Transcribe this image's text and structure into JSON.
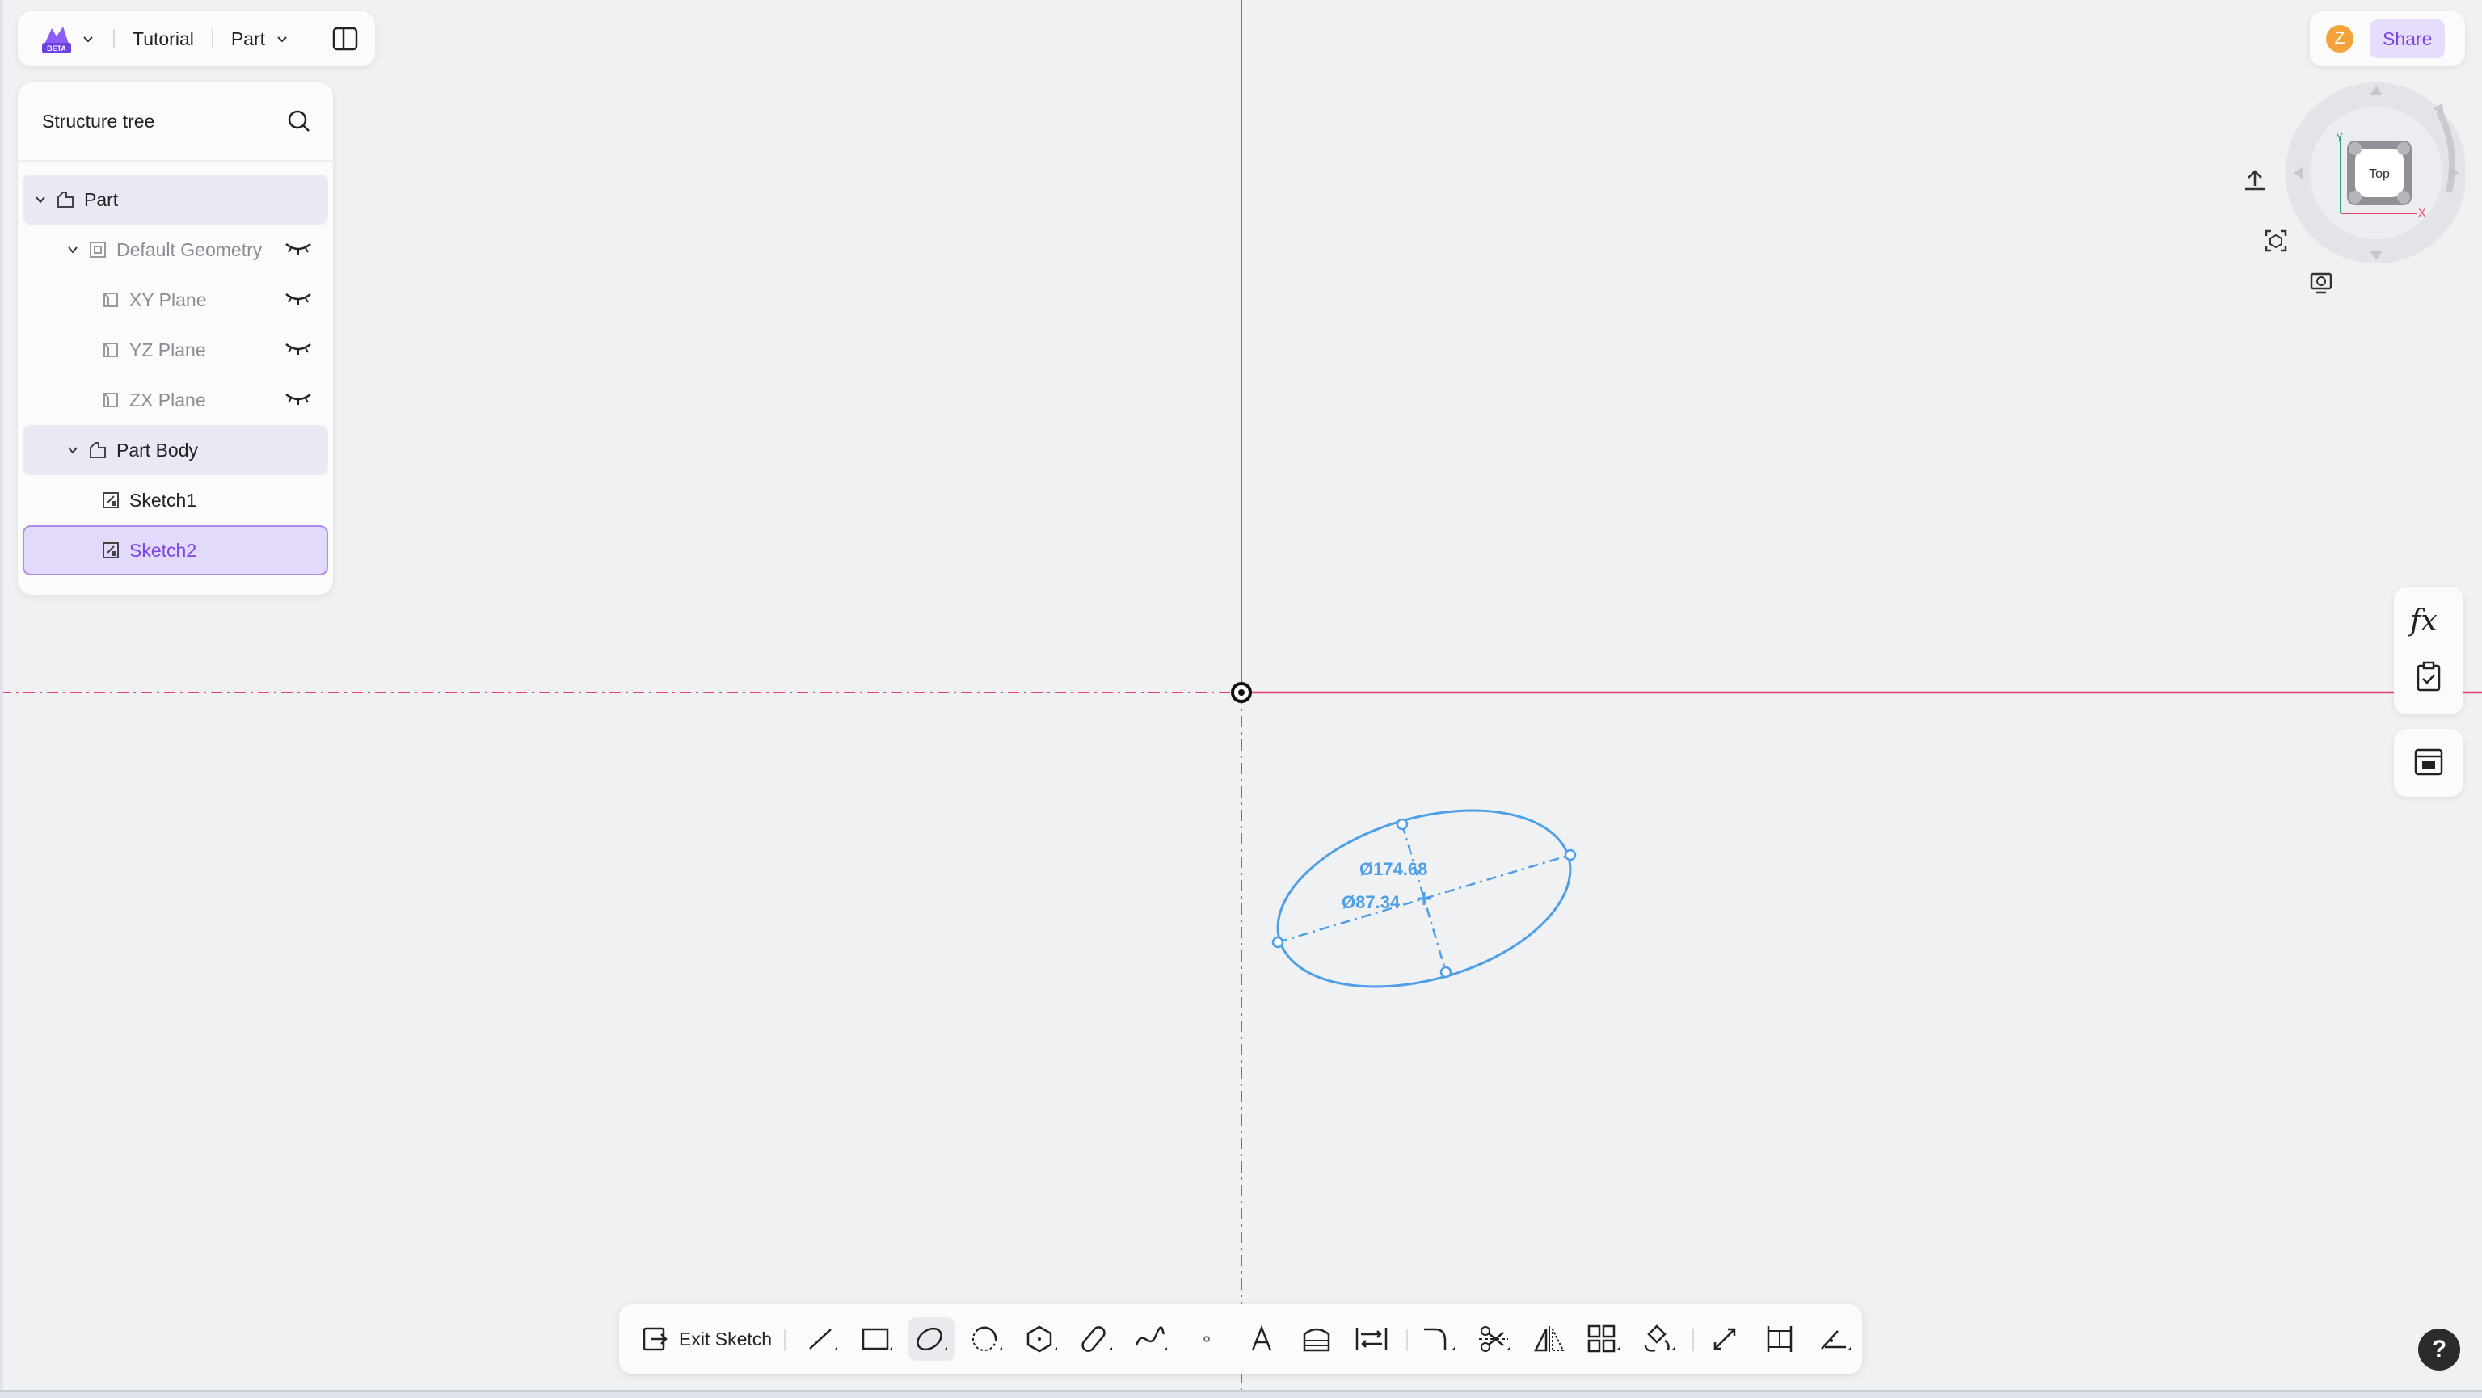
{
  "topbar": {
    "app_logo_badge": "BETA",
    "project_name": "Tutorial",
    "mode_label": "Part"
  },
  "tree": {
    "title": "Structure tree",
    "items": [
      {
        "label": "Part",
        "icon": "part-icon"
      },
      {
        "label": "Default Geometry",
        "icon": "geometry-icon"
      },
      {
        "label": "XY Plane",
        "icon": "plane-icon"
      },
      {
        "label": "YZ Plane",
        "icon": "plane-icon"
      },
      {
        "label": "ZX Plane",
        "icon": "plane-icon"
      },
      {
        "label": "Part Body",
        "icon": "body-icon"
      },
      {
        "label": "Sketch1",
        "icon": "sketch-icon"
      },
      {
        "label": "Sketch2",
        "icon": "sketch-icon",
        "selected": true
      }
    ]
  },
  "user": {
    "avatar_initial": "Z",
    "share_label": "Share"
  },
  "view_cube": {
    "face_label": "Top",
    "axis_x": "X",
    "axis_y": "Y"
  },
  "sketch": {
    "major_diameter": "Ø174.68",
    "minor_diameter": "Ø87.34",
    "colors": {
      "x_axis": "#e8416a",
      "y_axis": "#2aa079",
      "geometry": "#4e9fe8"
    }
  },
  "right_tools": {
    "formula_label": "fx"
  },
  "toolbar": {
    "exit_label": "Exit Sketch",
    "tools": [
      "line-tool",
      "rectangle-tool",
      "ellipse-tool",
      "arc-tool",
      "polygon-tool",
      "slot-tool",
      "spline-tool",
      "point-tool",
      "text-tool",
      "offset-tool",
      "project-tool",
      "fillet-tool",
      "trim-tool",
      "mirror-tool",
      "pattern-tool",
      "transform-tool",
      "extend-tool",
      "dimension-tool",
      "constraint-tool"
    ],
    "active_tool": "ellipse-tool"
  },
  "help_label": "?"
}
